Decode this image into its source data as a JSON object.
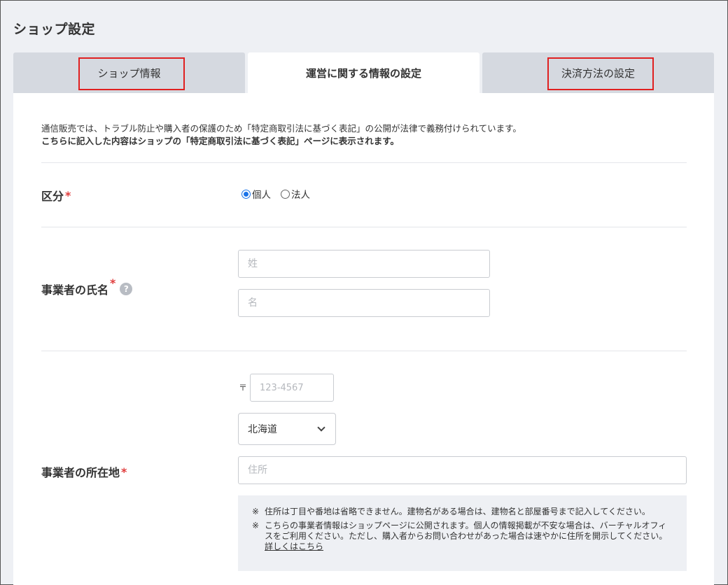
{
  "page": {
    "title": "ショップ設定"
  },
  "tabs": [
    {
      "label": "ショップ情報",
      "active": false
    },
    {
      "label": "運営に関する情報の設定",
      "active": true
    },
    {
      "label": "決済方法の設定",
      "active": false
    }
  ],
  "intro": {
    "line1": "通信販売では、トラブル防止や購入者の保護のため「特定商取引法に基づく表記」の公開が法律で義務付けられています。",
    "line2": "こちらに記入した内容はショップの「特定商取引法に基づく表記」ページに表示されます。"
  },
  "category": {
    "label": "区分",
    "required_mark": "*",
    "options": [
      {
        "label": "個人",
        "checked": true
      },
      {
        "label": "法人",
        "checked": false
      }
    ]
  },
  "name": {
    "label": "事業者の氏名",
    "required_mark": "*",
    "help_icon": "?",
    "last_placeholder": "姓",
    "first_placeholder": "名"
  },
  "address": {
    "label": "事業者の所在地",
    "required_mark": "*",
    "postal_mark": "〒",
    "postal_placeholder": "123-4567",
    "prefecture": "北海道",
    "address_placeholder": "住所",
    "notes": [
      {
        "mark": "※",
        "text": "住所は丁目や番地は省略できません。建物名がある場合は、建物名と部屋番号まで記入してください。"
      },
      {
        "mark": "※",
        "text": "こちらの事業者情報はショップページに公開されます。個人の情報掲載が不安な場合は、バーチャルオフィスをご利用ください。ただし、購入者からお問い合わせがあった場合は速やかに住所を開示してください。"
      }
    ],
    "details_link": "詳しくはこちら"
  },
  "colors": {
    "background": "#eef0f4",
    "tab_inactive": "#d5d9e0",
    "required": "#e03c3c",
    "highlight_box": "#e02020"
  },
  "icons": {
    "prefecture_dropdown": "chevron-down-icon",
    "name_help": "help-icon"
  }
}
